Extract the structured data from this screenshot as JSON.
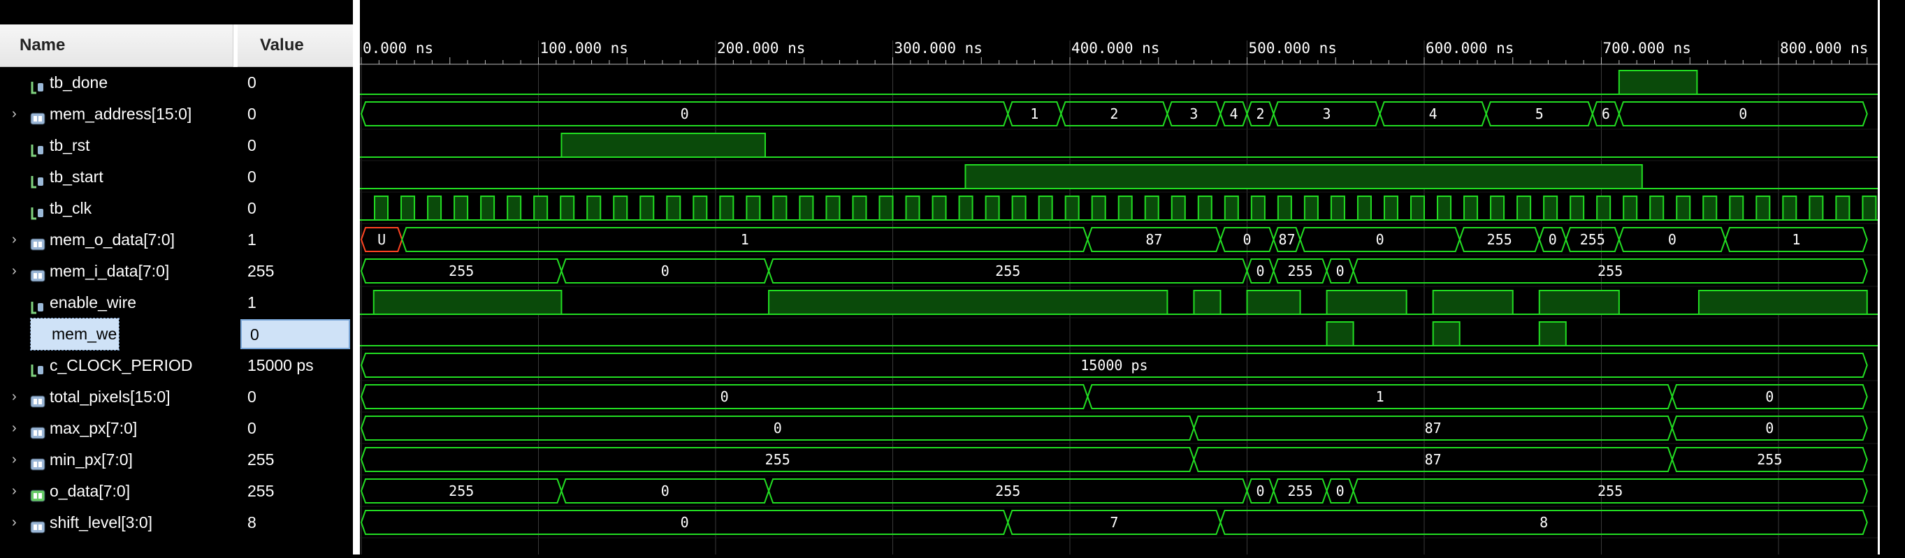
{
  "columns": {
    "name": "Name",
    "value": "Value"
  },
  "signals": [
    {
      "name": "tb_done",
      "value": "0",
      "icon": "bit-signal-icon",
      "expandable": false
    },
    {
      "name": "mem_address[15:0]",
      "value": "0",
      "icon": "bus-signal-icon",
      "expandable": true
    },
    {
      "name": "tb_rst",
      "value": "0",
      "icon": "bit-signal-icon",
      "expandable": false
    },
    {
      "name": "tb_start",
      "value": "0",
      "icon": "bit-signal-icon",
      "expandable": false
    },
    {
      "name": "tb_clk",
      "value": "0",
      "icon": "bit-signal-icon",
      "expandable": false
    },
    {
      "name": "mem_o_data[7:0]",
      "value": "1",
      "icon": "bus-signal-icon",
      "expandable": true
    },
    {
      "name": "mem_i_data[7:0]",
      "value": "255",
      "icon": "bus-signal-icon",
      "expandable": true
    },
    {
      "name": "enable_wire",
      "value": "1",
      "icon": "bit-signal-icon",
      "expandable": false
    },
    {
      "name": "mem_we",
      "value": "0",
      "icon": "bit-signal-icon",
      "expandable": false,
      "selected": true
    },
    {
      "name": "c_CLOCK_PERIOD",
      "value": "15000 ps",
      "icon": "bit-signal-icon",
      "expandable": false
    },
    {
      "name": "total_pixels[15:0]",
      "value": "0",
      "icon": "bus-signal-icon",
      "expandable": true
    },
    {
      "name": "max_px[7:0]",
      "value": "0",
      "icon": "bus-signal-icon",
      "expandable": true
    },
    {
      "name": "min_px[7:0]",
      "value": "255",
      "icon": "bus-signal-icon",
      "expandable": true
    },
    {
      "name": "o_data[7:0]",
      "value": "255",
      "icon": "bus-signal-icon-green",
      "expandable": true
    },
    {
      "name": "shift_level[3:0]",
      "value": "8",
      "icon": "bus-signal-icon",
      "expandable": true
    }
  ],
  "timeline": {
    "unit": "ns",
    "start": 0,
    "end": 850,
    "ticks": [
      "0.000 ns",
      "100.000 ns",
      "200.000 ns",
      "300.000 ns",
      "400.000 ns",
      "500.000 ns",
      "600.000 ns",
      "700.000 ns",
      "800.000 ns"
    ],
    "tick_values": [
      0,
      100,
      200,
      300,
      400,
      500,
      600,
      700,
      800
    ],
    "clock_period_ns": 15
  },
  "waves": [
    {
      "type": "bit",
      "highs": [
        [
          710,
          754
        ]
      ]
    },
    {
      "type": "bus",
      "segments": [
        [
          0,
          365,
          "0"
        ],
        [
          365,
          395,
          "1"
        ],
        [
          395,
          455,
          "2"
        ],
        [
          455,
          485,
          "3"
        ],
        [
          485,
          500,
          "4"
        ],
        [
          500,
          515,
          "2"
        ],
        [
          515,
          575,
          "3"
        ],
        [
          575,
          635,
          "4"
        ],
        [
          635,
          695,
          "5"
        ],
        [
          695,
          710,
          "6"
        ],
        [
          710,
          850,
          "0"
        ]
      ]
    },
    {
      "type": "bit",
      "highs": [
        [
          113,
          228
        ]
      ]
    },
    {
      "type": "bit",
      "highs": [
        [
          341,
          723
        ]
      ]
    },
    {
      "type": "clock"
    },
    {
      "type": "bus",
      "segments": [
        [
          0,
          23,
          "U"
        ],
        [
          23,
          410,
          "1"
        ],
        [
          410,
          485,
          "87"
        ],
        [
          485,
          515,
          "0"
        ],
        [
          515,
          530,
          "87"
        ],
        [
          530,
          620,
          "0"
        ],
        [
          620,
          665,
          "255"
        ],
        [
          665,
          680,
          "0"
        ],
        [
          680,
          710,
          "255"
        ],
        [
          710,
          770,
          "0"
        ],
        [
          770,
          850,
          "1"
        ]
      ]
    },
    {
      "type": "bus",
      "segments": [
        [
          0,
          113,
          "255"
        ],
        [
          113,
          230,
          "0"
        ],
        [
          230,
          500,
          "255"
        ],
        [
          500,
          515,
          "0"
        ],
        [
          515,
          545,
          "255"
        ],
        [
          545,
          560,
          "0"
        ],
        [
          560,
          850,
          "255"
        ]
      ]
    },
    {
      "type": "bit",
      "highs": [
        [
          7,
          113
        ],
        [
          230,
          455
        ],
        [
          470,
          485
        ],
        [
          500,
          530
        ],
        [
          545,
          590
        ],
        [
          605,
          650
        ],
        [
          665,
          710
        ],
        [
          755,
          850
        ]
      ]
    },
    {
      "type": "bit",
      "highs": [
        [
          545,
          560
        ],
        [
          605,
          620
        ],
        [
          665,
          680
        ]
      ]
    },
    {
      "type": "bus",
      "segments": [
        [
          0,
          850,
          "15000 ps"
        ]
      ]
    },
    {
      "type": "bus",
      "segments": [
        [
          0,
          410,
          "0"
        ],
        [
          410,
          740,
          "1"
        ],
        [
          740,
          850,
          "0"
        ]
      ]
    },
    {
      "type": "bus",
      "segments": [
        [
          0,
          470,
          "0"
        ],
        [
          470,
          740,
          "87"
        ],
        [
          740,
          850,
          "0"
        ]
      ]
    },
    {
      "type": "bus",
      "segments": [
        [
          0,
          470,
          "255"
        ],
        [
          470,
          740,
          "87"
        ],
        [
          740,
          850,
          "255"
        ]
      ]
    },
    {
      "type": "bus",
      "segments": [
        [
          0,
          113,
          "255"
        ],
        [
          113,
          230,
          "0"
        ],
        [
          230,
          500,
          "255"
        ],
        [
          500,
          515,
          "0"
        ],
        [
          515,
          545,
          "255"
        ],
        [
          545,
          560,
          "0"
        ],
        [
          560,
          850,
          "255"
        ]
      ]
    },
    {
      "type": "bus",
      "segments": [
        [
          0,
          365,
          "0"
        ],
        [
          365,
          485,
          "7"
        ],
        [
          485,
          850,
          "8"
        ]
      ]
    }
  ],
  "colors": {
    "wave": "#22dd22",
    "fill": "#0a4a0a",
    "grid": "#3a3a3a",
    "unknown": "#ff4422",
    "selected": "#cfe2f7"
  }
}
